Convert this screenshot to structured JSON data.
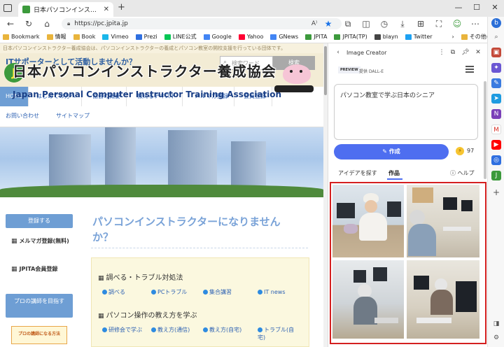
{
  "browser": {
    "tab_title": "日本パソコンインストラクター養成協会",
    "url": "https://pc.jpita.jp",
    "bookmarks": [
      {
        "label": "Bookmark",
        "color": "#e9b43c"
      },
      {
        "label": "情報",
        "color": "#e9b43c"
      },
      {
        "label": "Book",
        "color": "#e9b43c"
      },
      {
        "label": "Vimeo",
        "color": "#1ab7ea"
      },
      {
        "label": "Prezi",
        "color": "#2f6fe0"
      },
      {
        "label": "LINE公式",
        "color": "#06c755"
      },
      {
        "label": "Google",
        "color": "#4285f4"
      },
      {
        "label": "Yahoo",
        "color": "#ff0033"
      },
      {
        "label": "GNews",
        "color": "#4285f4"
      },
      {
        "label": "JPITA",
        "color": "#3c9a3c"
      },
      {
        "label": "JPITA(TP)",
        "color": "#3c9a3c"
      },
      {
        "label": "blayn",
        "color": "#444444"
      },
      {
        "label": "Twitter",
        "color": "#1da1f2"
      }
    ],
    "bookmarks_more": "›",
    "other_bookmarks": "その他のお気に入り"
  },
  "site": {
    "top_note": "日本パソコンインストラクター養成協会は、パソコンインストラクターの養成とパソコン教室の開校支援を行っている団体です。",
    "slogan": "ITサポーターとして活動しませんか？",
    "search_placeholder": "検索ワード",
    "search_button": "検索",
    "nav": [
      "HOME",
      "はじめての方へ",
      "協会の概要",
      "教えるテキスト",
      "メルマガ登録",
      "会員登録",
      "お問い合わせ",
      "サイトマップ"
    ],
    "banner_logo": "J",
    "banner_title": "日本パソコンインストラクター養成協会",
    "banner_subtitle": "Japan Personal Computer Instructor Training Association",
    "sidebar": {
      "register_button": "登録する",
      "mailmag": "メルマガ登録(無料)",
      "member": "JPITA会員登録",
      "pro_button": "プロの講師を目指す",
      "pro_banner": "プロの講師になる方法"
    },
    "main_heading": "パソコンインストラクターになりませんか？",
    "sections": [
      {
        "title": "調べる・トラブル対処法",
        "links": [
          "調べる",
          "PCトラブル",
          "集合講習",
          "IT news"
        ]
      },
      {
        "title": "パソコン操作の教え方を学ぶ",
        "links": [
          "研修会で学ぶ",
          "教え方(通信)",
          "教え方(自宅)",
          "トラブル(自宅)"
        ]
      }
    ]
  },
  "panel": {
    "title": "Image Creator",
    "preview_tag": "PREVIEW",
    "provider": "提供 DALL-E",
    "prompt": "パソコン教室で学ぶ日本のシニア",
    "create_label": "作成",
    "boost_count": "97",
    "tab_ideas": "アイデアを探す",
    "tab_works": "作品",
    "help": "ヘルプ"
  }
}
